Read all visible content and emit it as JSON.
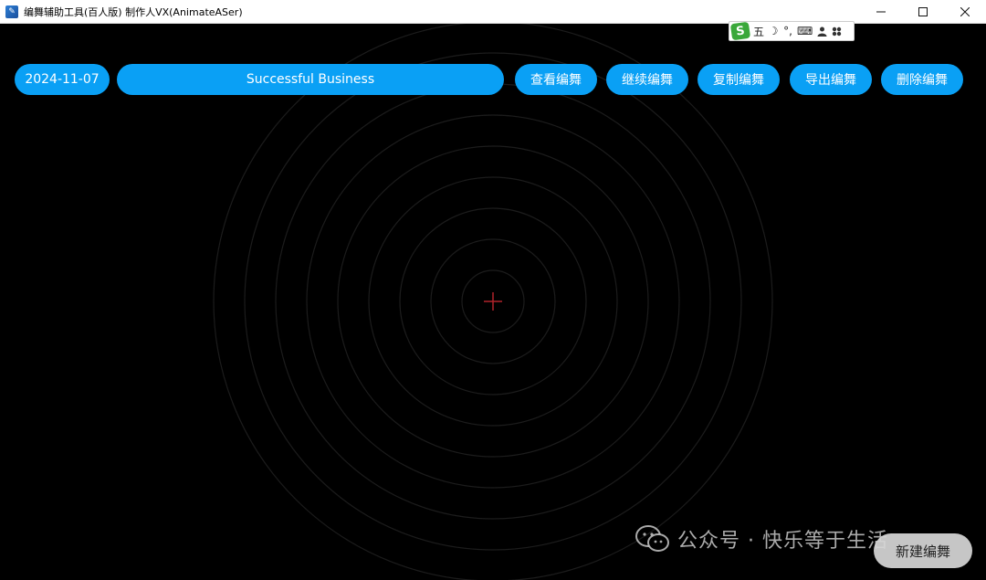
{
  "window": {
    "title": "编舞辅助工具(百人版)  制作人VX(AnimateASer)",
    "controls": {
      "minimize": "minimize",
      "maximize": "maximize",
      "close": "close"
    }
  },
  "ime": {
    "logo": "S",
    "mode": "五",
    "moon": "☽",
    "punct": "°,",
    "keyboard": "⌨",
    "user": "👤",
    "more": "⁘"
  },
  "header": {
    "date": "2024-11-07",
    "dance_name": "Successful Business"
  },
  "actions": [
    {
      "label": "查看编舞"
    },
    {
      "label": "继续编舞"
    },
    {
      "label": "复制编舞"
    },
    {
      "label": "导出编舞"
    },
    {
      "label": "删除编舞"
    }
  ],
  "footer": {
    "new_label": "新建编舞",
    "watermark": "公众号 · 快乐等于生活"
  },
  "colors": {
    "accent": "#0aa0f5",
    "background": "#000000",
    "ring": "#1c1c1c",
    "crosshair": "#b0222a"
  }
}
